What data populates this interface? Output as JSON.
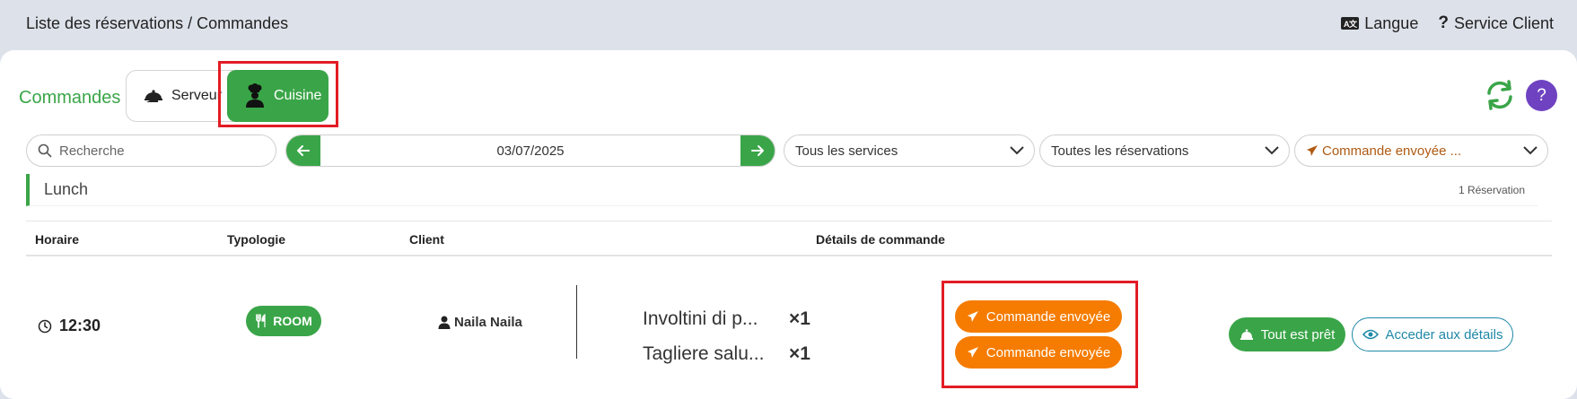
{
  "topbar": {
    "breadcrumb": "Liste des réservations / Commandes",
    "language_label": "Langue",
    "service_label": "Service Client"
  },
  "header": {
    "section_label": "Commandes",
    "tabs": [
      {
        "label": "Serveur",
        "active": false
      },
      {
        "label": "Cuisine",
        "active": true
      }
    ]
  },
  "filters": {
    "search_placeholder": "Recherche",
    "date": "03/07/2025",
    "service_select": "Tous les services",
    "reservation_select": "Toutes les réservations",
    "status_select": "Commande envoyée ..."
  },
  "service_group": {
    "name": "Lunch",
    "count_label": "1 Réservation"
  },
  "table": {
    "headers": {
      "time": "Horaire",
      "type": "Typologie",
      "client": "Client",
      "details": "Détails de commande"
    },
    "rows": [
      {
        "time": "12:30",
        "type": "ROOM",
        "client": "Naila Naila",
        "items": [
          {
            "name": "Involtini di p...",
            "qty": "×1",
            "status": "Commande envoyée"
          },
          {
            "name": "Tagliere salu...",
            "qty": "×1",
            "status": "Commande envoyée"
          }
        ],
        "ready_label": "Tout est prêt",
        "details_label": "Acceder aux détails"
      }
    ]
  },
  "colors": {
    "green": "#3aa548",
    "orange": "#f57c00",
    "purple": "#6f42c1",
    "teal": "#1e88a8",
    "highlight_red": "#e21c24"
  }
}
